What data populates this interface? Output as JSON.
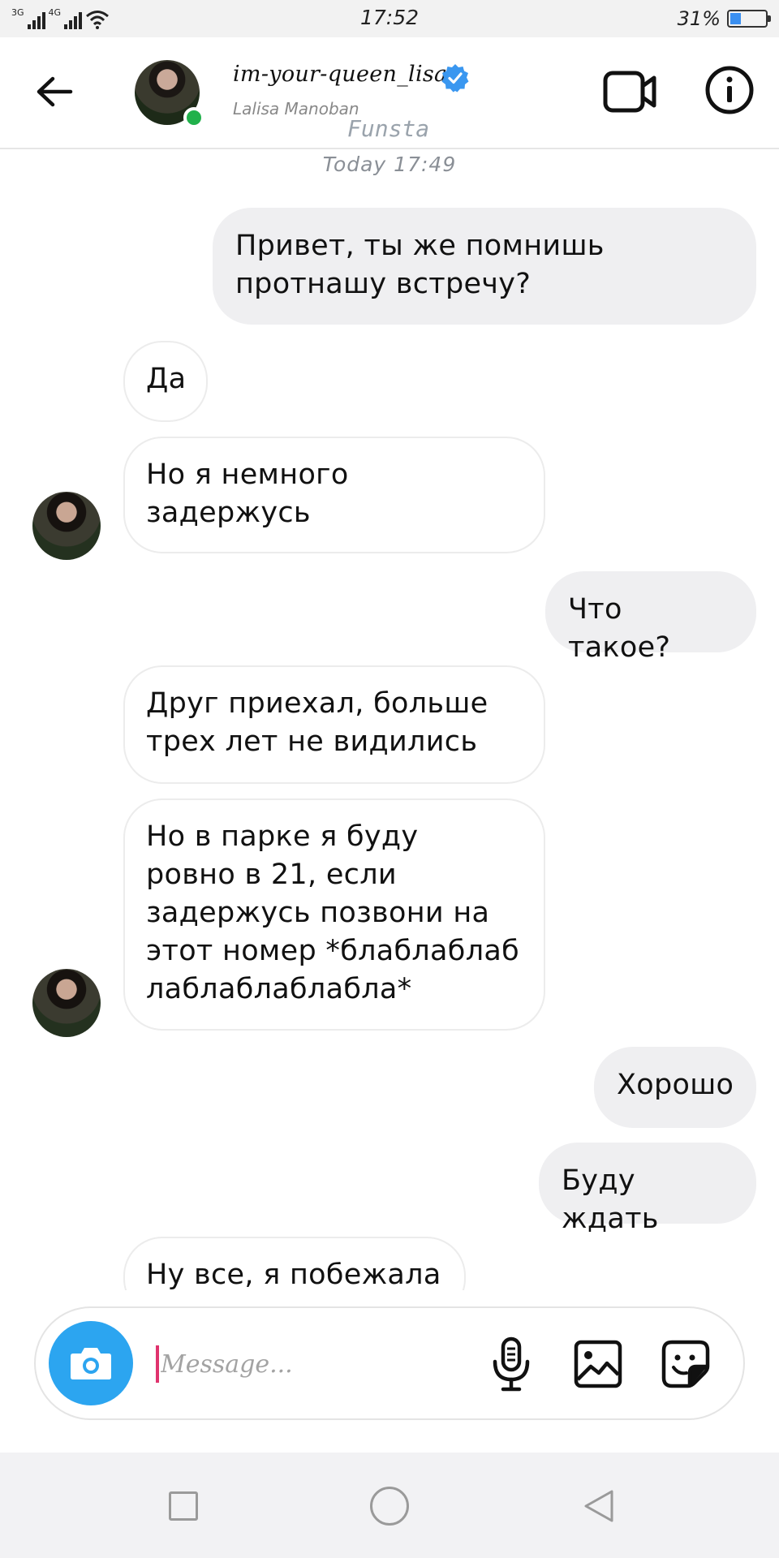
{
  "status_bar": {
    "network_1": "3G",
    "network_2": "4G",
    "time": "17:52",
    "battery_percent": "31%",
    "battery_level": 0.31
  },
  "header": {
    "username": "im-your-queen_lisa",
    "full_name": "Lalisa Manoban",
    "watermark": "Funsta",
    "verified": true,
    "online": true
  },
  "chat": {
    "timestamp": "Today 17:49",
    "messages": [
      {
        "direction": "out",
        "text": "Привет, ты же помнишь\nпротнашу встречу?"
      },
      {
        "direction": "in",
        "text": "Да"
      },
      {
        "direction": "in",
        "text": "Но я немного\nзадержусь"
      },
      {
        "direction": "out",
        "text": "Что такое?"
      },
      {
        "direction": "in",
        "text": "Друг приехал, больше\nтрех лет не видились"
      },
      {
        "direction": "in",
        "text": "Но в парке я буду\nровно в 21, если\nзадержусь позвони на\nэтот номер *блаблаблаб\nлаблаблаблабла*"
      },
      {
        "direction": "out",
        "text": "Хорошо"
      },
      {
        "direction": "out",
        "text": "Буду ждать"
      },
      {
        "direction": "in",
        "text": "Ну все, я побежала"
      }
    ]
  },
  "composer": {
    "placeholder": "Message...",
    "value": ""
  },
  "colors": {
    "accent_blue": "#2ca5f0",
    "online_green": "#21b14b",
    "outgoing_bubble": "#efeff1",
    "caret_pink": "#e0336d"
  },
  "icons": {
    "back": "arrow-left-icon",
    "video": "video-camera-icon",
    "info": "info-icon",
    "camera": "camera-icon",
    "mic": "microphone-icon",
    "gallery": "image-icon",
    "sticker": "sticker-icon"
  }
}
